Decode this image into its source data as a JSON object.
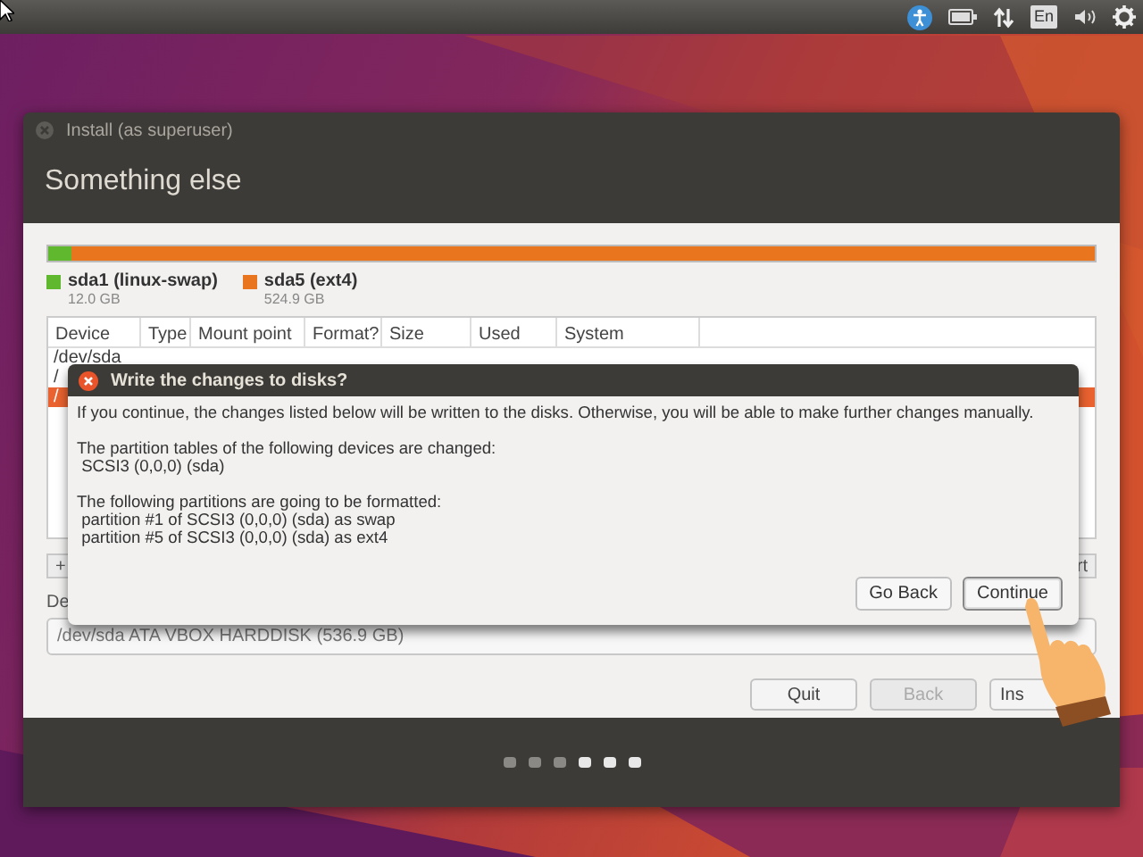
{
  "top_panel": {
    "keyboard_layout": "En"
  },
  "window": {
    "title": "Install (as superuser)",
    "heading": "Something else",
    "partitions": [
      {
        "name": "sda1 (linux-swap)",
        "size": "12.0 GB",
        "color": "#5fb82e",
        "level": 0.022
      },
      {
        "name": "sda5 (ext4)",
        "size": "524.9 GB",
        "color": "#e9751f",
        "level": 0.978
      }
    ],
    "table": {
      "columns": [
        "Device",
        "Type",
        "Mount point",
        "Format?",
        "Size",
        "Used",
        "System"
      ],
      "rows": [
        {
          "device": "/dev/sda",
          "selected": false
        },
        {
          "device": "/",
          "selected": false
        },
        {
          "device": "/",
          "selected": true
        }
      ]
    },
    "add_button": "+",
    "revert_button": "rt",
    "boot_label": "De",
    "boot_device": "/dev/sda   ATA VBOX HARDDISK (536.9 GB)",
    "buttons": [
      {
        "label": "Quit",
        "disabled": false
      },
      {
        "label": "Back",
        "disabled": true
      },
      {
        "label": "Ins",
        "disabled": false
      }
    ],
    "steps": [
      {
        "highlighted": false
      },
      {
        "highlighted": false
      },
      {
        "highlighted": false
      },
      {
        "highlighted": true
      },
      {
        "highlighted": true
      },
      {
        "highlighted": true
      }
    ]
  },
  "dialog": {
    "title": "Write the changes to disks?",
    "paragraphs": [
      [
        "If you continue, the changes listed below will be written to the disks. Otherwise, you will be able to make further changes manually."
      ],
      [
        "The partition tables of the following devices are changed:",
        " SCSI3 (0,0,0) (sda)"
      ],
      [
        "The following partitions are going to be formatted:",
        " partition #1 of SCSI3 (0,0,0) (sda) as swap",
        " partition #5 of SCSI3 (0,0,0) (sda) as ext4"
      ]
    ],
    "buttons": [
      {
        "label": "Go Back",
        "focused": false
      },
      {
        "label": "Continue",
        "focused": true
      }
    ]
  }
}
